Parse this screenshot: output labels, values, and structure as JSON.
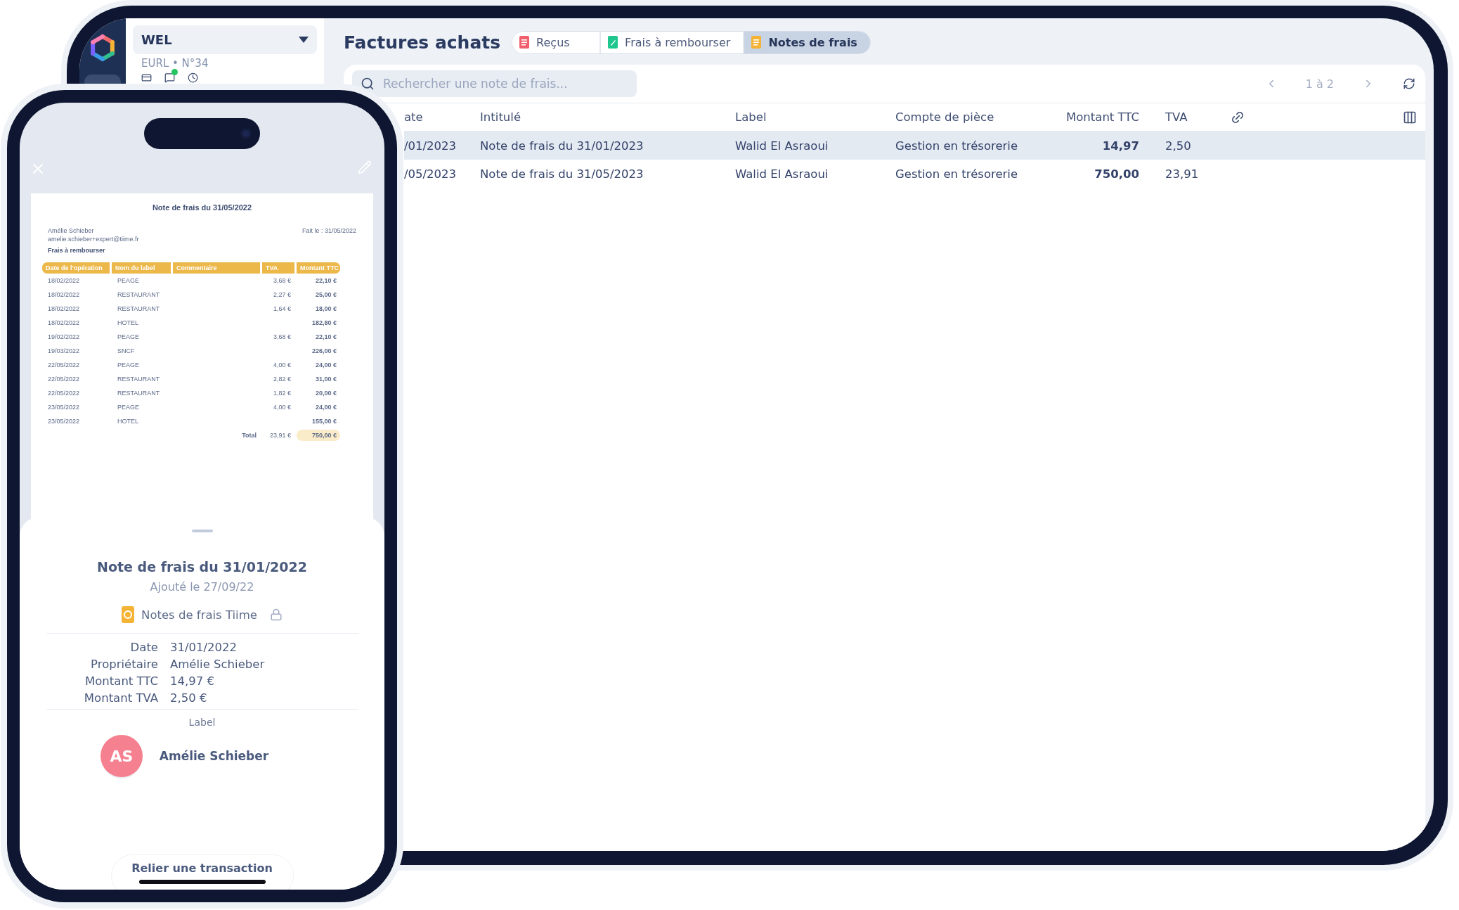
{
  "tablet": {
    "company": {
      "name": "WEL",
      "subtitle": "EURL • N°34"
    },
    "page_title": "Factures achats",
    "tabs": [
      {
        "label": "Reçus",
        "kind": "receipt",
        "selected": false
      },
      {
        "label": "Frais à rembourser",
        "kind": "refund",
        "selected": false
      },
      {
        "label": "Notes de frais",
        "kind": "expense",
        "selected": true
      }
    ],
    "search": {
      "placeholder": "Rechercher une note de frais..."
    },
    "pagination": "1 à 2",
    "table": {
      "columns": [
        "ate",
        "Intitulé",
        "Label",
        "Compte de pièce",
        "Montant TTC",
        "TVA"
      ],
      "rows": [
        {
          "selected": true,
          "cells": [
            "/01/2023",
            "Note de frais du 31/01/2023",
            "Walid El Asraoui",
            "Gestion en trésorerie",
            "14,97",
            "2,50"
          ]
        },
        {
          "selected": false,
          "cells": [
            "/05/2023",
            "Note de frais du 31/05/2023",
            "Walid El Asraoui",
            "Gestion en trésorerie",
            "750,00",
            "23,91"
          ]
        }
      ]
    }
  },
  "phone": {
    "document": {
      "title": "Note de frais du 31/05/2022",
      "author": "Amélie Schieber",
      "email": "amelie.schieber+expert@tiime.fr",
      "date": "Fait le : 31/05/2022",
      "section": "Frais à rembourser",
      "columns": [
        "Date de l'opération",
        "Nom du label",
        "Commentaire",
        "TVA",
        "Montant TTC"
      ],
      "rows": [
        {
          "date": "18/02/2022",
          "label": "PEAGE",
          "tva": "3,68 €",
          "amount": "22,10 €"
        },
        {
          "date": "18/02/2022",
          "label": "RESTAURANT",
          "tva": "2,27 €",
          "amount": "25,00 €"
        },
        {
          "date": "18/02/2022",
          "label": "RESTAURANT",
          "tva": "1,64 €",
          "amount": "18,00 €"
        },
        {
          "date": "18/02/2022",
          "label": "HOTEL",
          "amount": "182,80 €"
        },
        {
          "date": "19/02/2022",
          "label": "PEAGE",
          "tva": "3,68 €",
          "amount": "22,10 €"
        },
        {
          "date": "19/03/2022",
          "label": "SNCF",
          "amount": "226,00 €"
        },
        {
          "date": "22/05/2022",
          "label": "PEAGE",
          "tva": "4,00 €",
          "amount": "24,00 €"
        },
        {
          "date": "22/05/2022",
          "label": "RESTAURANT",
          "tva": "2,82 €",
          "amount": "31,00 €"
        },
        {
          "date": "22/05/2022",
          "label": "RESTAURANT",
          "tva": "1,82 €",
          "amount": "20,00 €"
        },
        {
          "date": "23/05/2022",
          "label": "PEAGE",
          "tva": "4,00 €",
          "amount": "24,00 €"
        },
        {
          "date": "23/05/2022",
          "label": "HOTEL",
          "amount": "155,00 €"
        }
      ],
      "total": {
        "label": "Total",
        "tva": "23,91 €",
        "amount": "750,00 €"
      }
    },
    "sheet": {
      "title": "Note de frais du 31/01/2022",
      "added": "Ajouté le 27/09/22",
      "source": "Notes de frais Tiime",
      "locked": true,
      "details": [
        {
          "label": "Date",
          "value": "31/01/2022"
        },
        {
          "label": "Propriétaire",
          "value": "Amélie Schieber"
        },
        {
          "label": "Montant TTC",
          "value": "14,97 €"
        },
        {
          "label": "Montant TVA",
          "value": "2,50 €"
        }
      ],
      "label_heading": "Label",
      "tag": {
        "initials": "AS",
        "name": "Amélie Schieber"
      },
      "button": "Relier une transaction"
    }
  }
}
